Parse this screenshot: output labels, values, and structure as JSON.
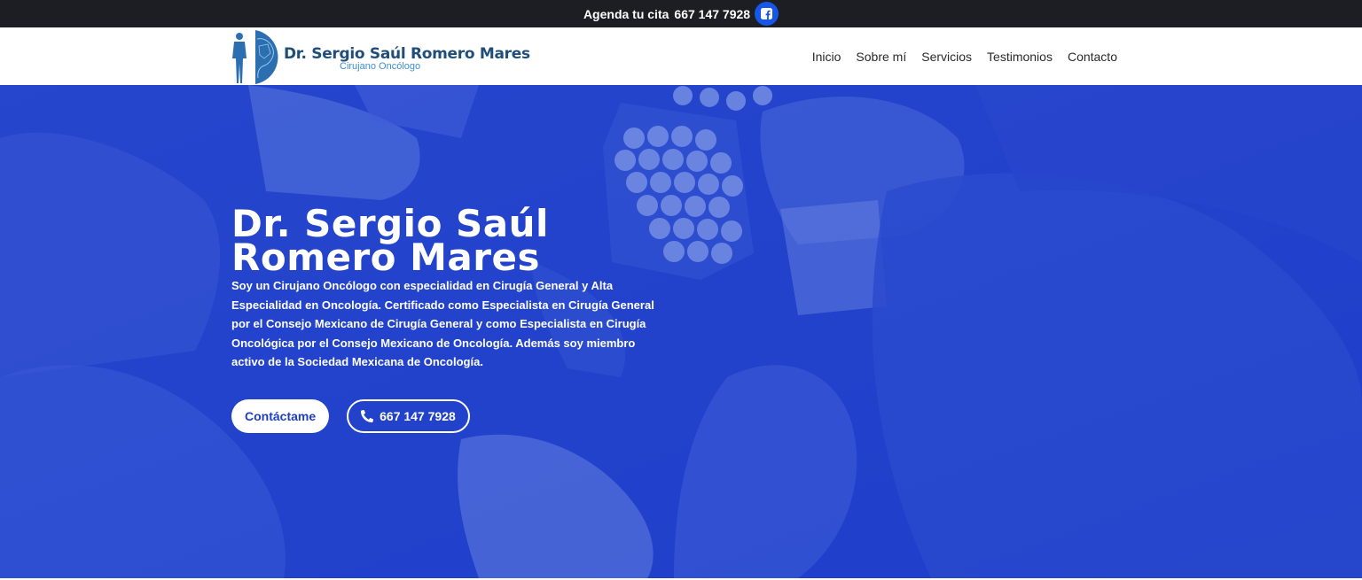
{
  "topbar": {
    "label": "Agenda tu cita",
    "phone": "667 147 7928",
    "facebook_icon": "facebook-icon"
  },
  "logo": {
    "name": "Dr. Sergio Saúl Romero Mares",
    "subtitle": "Cirujano Oncólogo"
  },
  "nav": {
    "items": [
      {
        "label": "Inicio"
      },
      {
        "label": "Sobre mí"
      },
      {
        "label": "Servicios"
      },
      {
        "label": "Testimonios"
      },
      {
        "label": "Contacto"
      }
    ]
  },
  "hero": {
    "title": "Dr. Sergio Saúl\nRomero Mares",
    "description": "Soy un Cirujano Oncólogo con especialidad en Cirugía General y Alta Especialidad en Oncología. Certificado como Especialista en Cirugía General por el Consejo Mexicano de Cirugía General y como Especialista en Cirugía Oncológica por el Consejo Mexicano de Oncología. Además soy miembro activo de la Sociedad Mexicana de Oncología.",
    "contact_button": "Contáctame",
    "phone_button": "667 147 7928",
    "phone_icon": "phone-icon"
  },
  "colors": {
    "topbar_bg": "#1c1e24",
    "hero_blue": "#1e3ec9",
    "brand_dark": "#1f4e7a",
    "brand_light": "#3d8fd0",
    "facebook_blue": "#1657e8"
  }
}
